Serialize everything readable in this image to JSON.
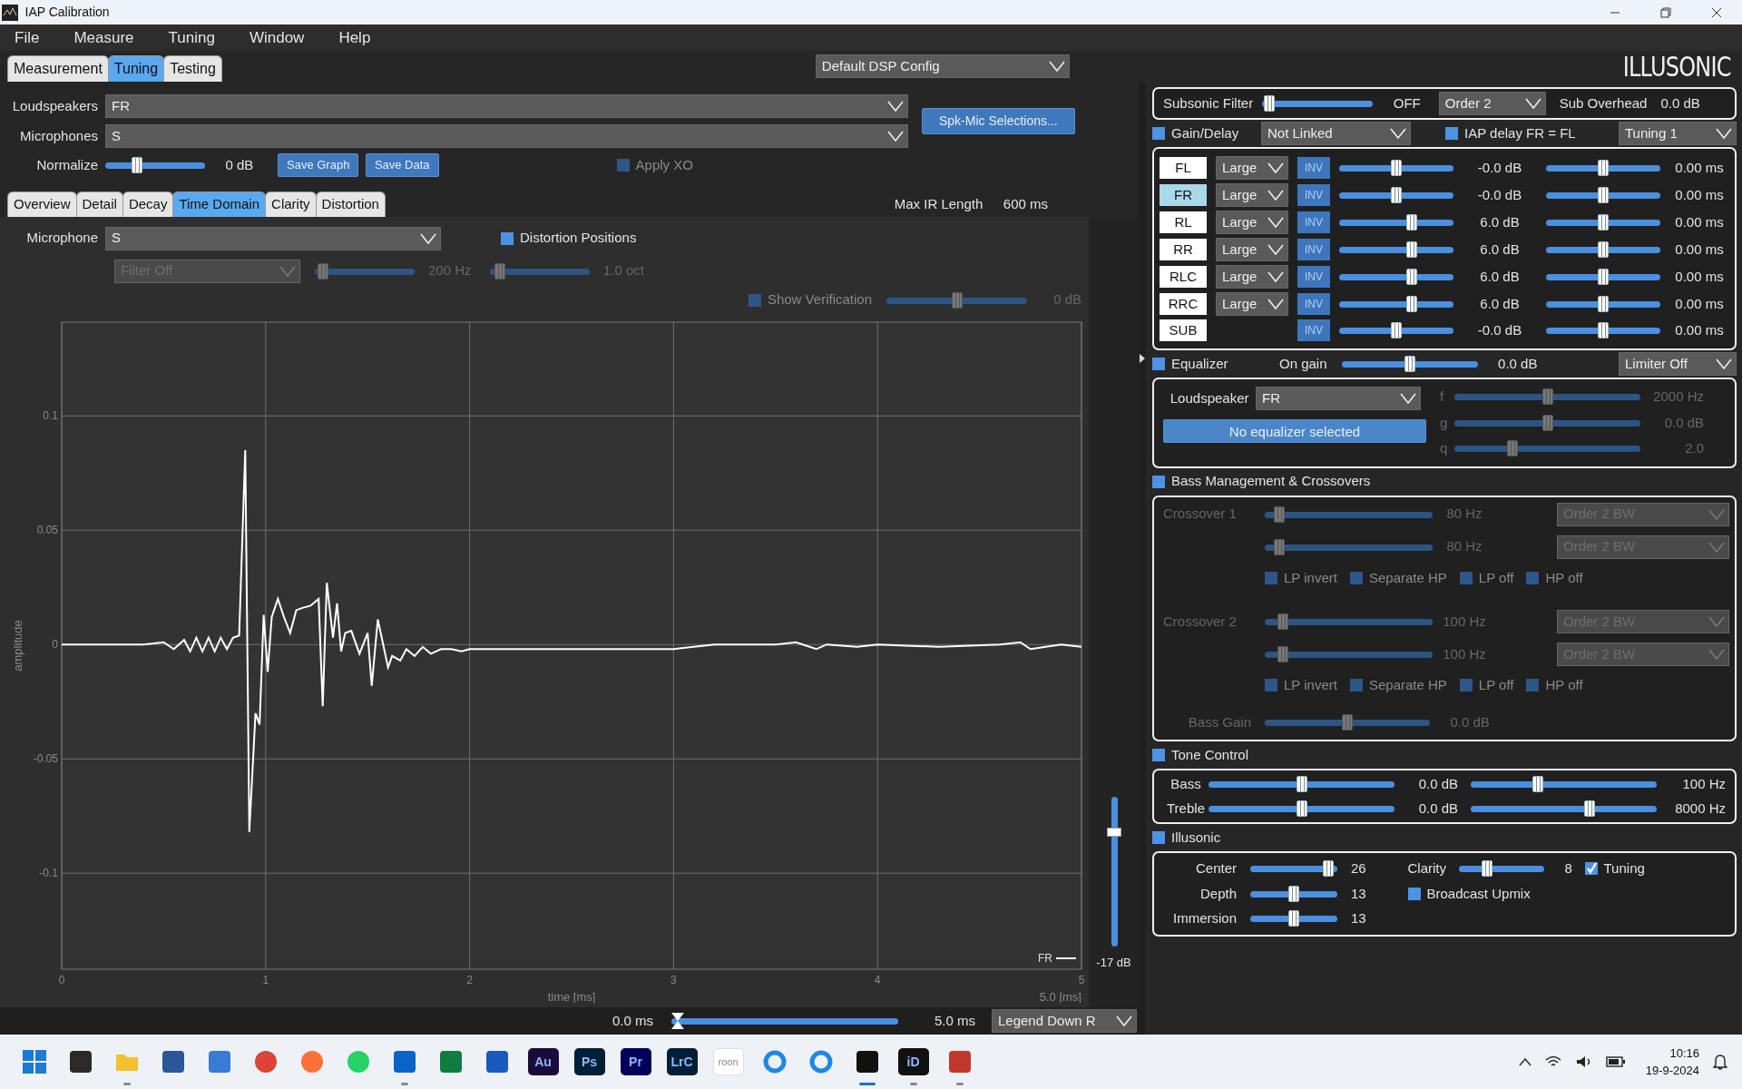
{
  "window": {
    "title": "IAP Calibration"
  },
  "menu": [
    "File",
    "Measure",
    "Tuning",
    "Window",
    "Help"
  ],
  "main_tabs": [
    {
      "label": "Measurement",
      "selected": false
    },
    {
      "label": "Tuning",
      "selected": true
    },
    {
      "label": "Testing",
      "selected": false
    }
  ],
  "dsp_config": "Default DSP Config",
  "logo": "ILLUSONIC",
  "selection": {
    "loudspeakers": {
      "label": "Loudspeakers",
      "value": "FR"
    },
    "microphones": {
      "label": "Microphones",
      "value": "S"
    },
    "button": "Spk-Mic Selections..."
  },
  "normalize": {
    "label": "Normalize",
    "level": 0.3,
    "reading": "0 dB",
    "buttons": [
      "Save Graph",
      "Save Data"
    ],
    "apply_xo": {
      "label": "Apply XO",
      "checked": false,
      "disabled": true
    }
  },
  "view_tabs": [
    {
      "label": "Overview",
      "selected": false
    },
    {
      "label": "Detail",
      "selected": false
    },
    {
      "label": "Decay",
      "selected": false
    },
    {
      "label": "Time Domain",
      "selected": true
    },
    {
      "label": "Clarity",
      "selected": false
    },
    {
      "label": "Distortion",
      "selected": false
    }
  ],
  "max_ir": {
    "label": "Max IR Length",
    "value": "600 ms"
  },
  "microphone": {
    "label": "Microphone",
    "value": "S",
    "distortion_positions": {
      "label": "Distortion Positions",
      "checked": false,
      "disabled": false
    }
  },
  "filter": {
    "value": "Filter Off",
    "disabled": true,
    "frequency": {
      "level": 0.03,
      "reading": "200 Hz"
    },
    "width": {
      "level": 0.05,
      "reading": "1.0 oct"
    }
  },
  "verification": {
    "label": "Show Verification",
    "checked": false,
    "disabled": true,
    "level": 0.5,
    "reading": "0 dB"
  },
  "chart": {
    "x_end_label": "5.0 [ms]",
    "chart_data": {
      "type": "line",
      "grid": true,
      "xlabel": "time [ms]",
      "ylabel": "amplitude",
      "xlim": [
        0,
        5
      ],
      "ylim": [
        -0.142,
        0.141
      ],
      "xticks": [
        0,
        1,
        2,
        3,
        4,
        5
      ],
      "yticks": [
        -0.1,
        -0.05,
        0,
        0.05,
        0.1
      ],
      "x": [
        0,
        0.2,
        0.4,
        0.5,
        0.55,
        0.6,
        0.63,
        0.66,
        0.69,
        0.72,
        0.75,
        0.78,
        0.81,
        0.84,
        0.87,
        0.9,
        0.92,
        0.95,
        0.97,
        0.99,
        1.01,
        1.03,
        1.06,
        1.09,
        1.12,
        1.15,
        1.18,
        1.22,
        1.26,
        1.28,
        1.3,
        1.33,
        1.35,
        1.37,
        1.39,
        1.42,
        1.46,
        1.5,
        1.52,
        1.55,
        1.6,
        1.62,
        1.66,
        1.69,
        1.73,
        1.77,
        1.81,
        1.86,
        1.91,
        1.96,
        2.0,
        2.3,
        2.6,
        3.0,
        3.2,
        3.5,
        3.6,
        3.7,
        3.75,
        3.9,
        4.0,
        4.3,
        4.6,
        4.7,
        4.75,
        4.9,
        5.0
      ],
      "series": [
        {
          "name": "FR",
          "color": "#ffffff",
          "values": [
            0,
            0,
            0,
            0.001,
            -0.002,
            0.002,
            -0.003,
            0.003,
            -0.003,
            0.003,
            -0.003,
            0.003,
            -0.002,
            0.003,
            0.004,
            0.085,
            -0.082,
            -0.03,
            -0.035,
            0.013,
            -0.012,
            0.012,
            0.02,
            0.012,
            0.005,
            0.015,
            0.016,
            0.017,
            0.02,
            -0.027,
            0.027,
            0.003,
            0.018,
            -0.003,
            0.005,
            0.006,
            -0.004,
            0.005,
            -0.018,
            0.011,
            -0.01,
            -0.005,
            -0.007,
            -0.002,
            -0.005,
            -0.001,
            -0.004,
            -0.002,
            -0.002,
            -0.003,
            -0.002,
            -0.002,
            -0.002,
            -0.002,
            0,
            0,
            0.001,
            -0.002,
            0,
            -0.001,
            0,
            -0.001,
            0,
            0.001,
            -0.002,
            0,
            -0.001
          ]
        }
      ]
    }
  },
  "output_gain": {
    "level": 0.78,
    "reading": "-17 dB"
  },
  "range": {
    "start": "0.0 ms",
    "end": "5.0 ms",
    "level": 0
  },
  "legend_position": "Legend Down R",
  "subsonic": {
    "label": "Subsonic Filter",
    "level": 0.02,
    "reading": "OFF",
    "order": "Order 2",
    "overhead_label": "Sub Overhead",
    "overhead": "0.0 dB"
  },
  "gain_delay": {
    "label": "Gain/Delay",
    "checked": false,
    "link": "Not Linked",
    "iap_delay": {
      "label": "IAP delay FR = FL",
      "checked": false
    },
    "tuning": "Tuning 1",
    "channels": [
      {
        "name": "FL",
        "selected": false,
        "size": "Large",
        "invert": "INV",
        "gain": {
          "level": 0.5,
          "reading": "-0.0 dB"
        },
        "delay": {
          "level": 0.5,
          "reading": "0.00 ms"
        }
      },
      {
        "name": "FR",
        "selected": true,
        "size": "Large",
        "invert": "INV",
        "gain": {
          "level": 0.5,
          "reading": "-0.0 dB"
        },
        "delay": {
          "level": 0.5,
          "reading": "0.00 ms"
        }
      },
      {
        "name": "RL",
        "selected": false,
        "size": "Large",
        "invert": "INV",
        "gain": {
          "level": 0.65,
          "reading": "6.0 dB"
        },
        "delay": {
          "level": 0.5,
          "reading": "0.00 ms"
        }
      },
      {
        "name": "RR",
        "selected": false,
        "size": "Large",
        "invert": "INV",
        "gain": {
          "level": 0.65,
          "reading": "6.0 dB"
        },
        "delay": {
          "level": 0.5,
          "reading": "0.00 ms"
        }
      },
      {
        "name": "RLC",
        "selected": false,
        "size": "Large",
        "invert": "INV",
        "gain": {
          "level": 0.65,
          "reading": "6.0 dB"
        },
        "delay": {
          "level": 0.5,
          "reading": "0.00 ms"
        }
      },
      {
        "name": "RRC",
        "selected": false,
        "size": "Large",
        "invert": "INV",
        "gain": {
          "level": 0.65,
          "reading": "6.0 dB"
        },
        "delay": {
          "level": 0.5,
          "reading": "0.00 ms"
        }
      },
      {
        "name": "SUB",
        "selected": false,
        "invert": "INV",
        "gain": {
          "level": 0.5,
          "reading": "-0.0 dB"
        },
        "delay": {
          "level": 0.5,
          "reading": "0.00 ms"
        }
      }
    ]
  },
  "equalizer": {
    "label": "Equalizer",
    "checked": false,
    "gain_label": "On gain",
    "level": 0.5,
    "reading": "0.0 dB",
    "limiter": "Limiter Off",
    "loudspeaker_label": "Loudspeaker",
    "loudspeaker": "FR",
    "status": "No equalizer selected",
    "params": [
      {
        "name": "f",
        "level": 0.5,
        "reading": "2000 Hz"
      },
      {
        "name": "g",
        "level": 0.5,
        "reading": "0.0 dB"
      },
      {
        "name": "q",
        "level": 0.3,
        "reading": "2.0"
      }
    ]
  },
  "bass_management": {
    "label": "Bass Management & Crossovers",
    "checked": false,
    "disabled": true,
    "crossovers": [
      {
        "label": "Crossover 1",
        "filters": [
          {
            "level": 0.06,
            "reading": "80 Hz",
            "order": "Order 2 BW"
          },
          {
            "level": 0.06,
            "reading": "80 Hz",
            "order": "Order 2 BW"
          }
        ],
        "options": [
          {
            "label": "LP invert",
            "checked": false
          },
          {
            "label": "Separate HP",
            "checked": false
          },
          {
            "label": "LP off",
            "checked": false
          },
          {
            "label": "HP off",
            "checked": false
          }
        ]
      },
      {
        "label": "Crossover 2",
        "filters": [
          {
            "level": 0.08,
            "reading": "100 Hz",
            "order": "Order 2 BW"
          },
          {
            "level": 0.08,
            "reading": "100 Hz",
            "order": "Order 2 BW"
          }
        ],
        "options": [
          {
            "label": "LP invert",
            "checked": false
          },
          {
            "label": "Separate HP",
            "checked": false
          },
          {
            "label": "LP off",
            "checked": false
          },
          {
            "label": "HP off",
            "checked": false
          }
        ]
      }
    ],
    "bass_gain": {
      "label": "Bass Gain",
      "level": 0.5,
      "reading": "0.0 dB"
    }
  },
  "tone_control": {
    "label": "Tone Control",
    "checked": false,
    "rows": [
      {
        "label": "Bass",
        "gain": {
          "level": 0.5,
          "reading": "0.0 dB"
        },
        "frequency": {
          "level": 0.35,
          "reading": "100 Hz"
        }
      },
      {
        "label": "Treble",
        "gain": {
          "level": 0.5,
          "reading": "0.0 dB"
        },
        "frequency": {
          "level": 0.65,
          "reading": "8000 Hz"
        }
      }
    ]
  },
  "illusonic": {
    "label": "Illusonic",
    "checked": false,
    "sliders": [
      {
        "label": "Center",
        "level": 0.95,
        "reading": "26"
      },
      {
        "label": "Depth",
        "level": 0.5,
        "reading": "13"
      },
      {
        "label": "Immersion",
        "level": 0.5,
        "reading": "13"
      }
    ],
    "clarity": {
      "label": "Clarity",
      "level": 0.3,
      "reading": "8"
    },
    "options": [
      {
        "label": "Tuning",
        "checked": true
      },
      {
        "label": "Broadcast Upmix",
        "checked": false
      }
    ]
  },
  "taskbar": {
    "apps": [
      {
        "kind": "windows",
        "running": false,
        "selected": false
      },
      {
        "kind": "square",
        "color": "#2a2a2a",
        "running": false,
        "selected": false
      },
      {
        "kind": "folder",
        "color": "#f2c12e",
        "running": true,
        "selected": false
      },
      {
        "kind": "square",
        "color": "#2b5797",
        "running": false,
        "selected": false
      },
      {
        "kind": "square",
        "color": "#3a7bd5",
        "running": false,
        "selected": false
      },
      {
        "kind": "circle",
        "color": "#db4437",
        "running": false,
        "selected": false
      },
      {
        "kind": "circle",
        "color": "#ff7139",
        "running": false,
        "selected": false
      },
      {
        "kind": "circle",
        "color": "#25d366",
        "running": false,
        "selected": false
      },
      {
        "kind": "square",
        "color": "#0a64c8",
        "running": true,
        "selected": false
      },
      {
        "kind": "square",
        "color": "#107c41",
        "running": false,
        "selected": false
      },
      {
        "kind": "square",
        "color": "#185abd",
        "running": false,
        "selected": false
      },
      {
        "kind": "text",
        "label": "Au",
        "color": "#1a0b3b",
        "running": false,
        "selected": false
      },
      {
        "kind": "text",
        "label": "Ps",
        "color": "#001e36",
        "running": false,
        "selected": false
      },
      {
        "kind": "text",
        "label": "Pr",
        "color": "#00005b",
        "running": false,
        "selected": false
      },
      {
        "kind": "text",
        "label": "LrC",
        "color": "#001e36",
        "running": false,
        "selected": false
      },
      {
        "kind": "text",
        "label": "roon",
        "color": "#ffffff",
        "running": false,
        "selected": false
      },
      {
        "kind": "ring",
        "color": "#1e88e5",
        "running": false,
        "selected": false
      },
      {
        "kind": "ring",
        "color": "#1e88e5",
        "running": false,
        "selected": false
      },
      {
        "kind": "square",
        "color": "#111111",
        "running": true,
        "selected": true
      },
      {
        "kind": "text",
        "label": "iD",
        "color": "#111111",
        "running": true,
        "selected": false
      },
      {
        "kind": "square",
        "color": "#c0392b",
        "running": true,
        "selected": false
      }
    ],
    "time": "10:16",
    "date": "19-9-2024"
  }
}
